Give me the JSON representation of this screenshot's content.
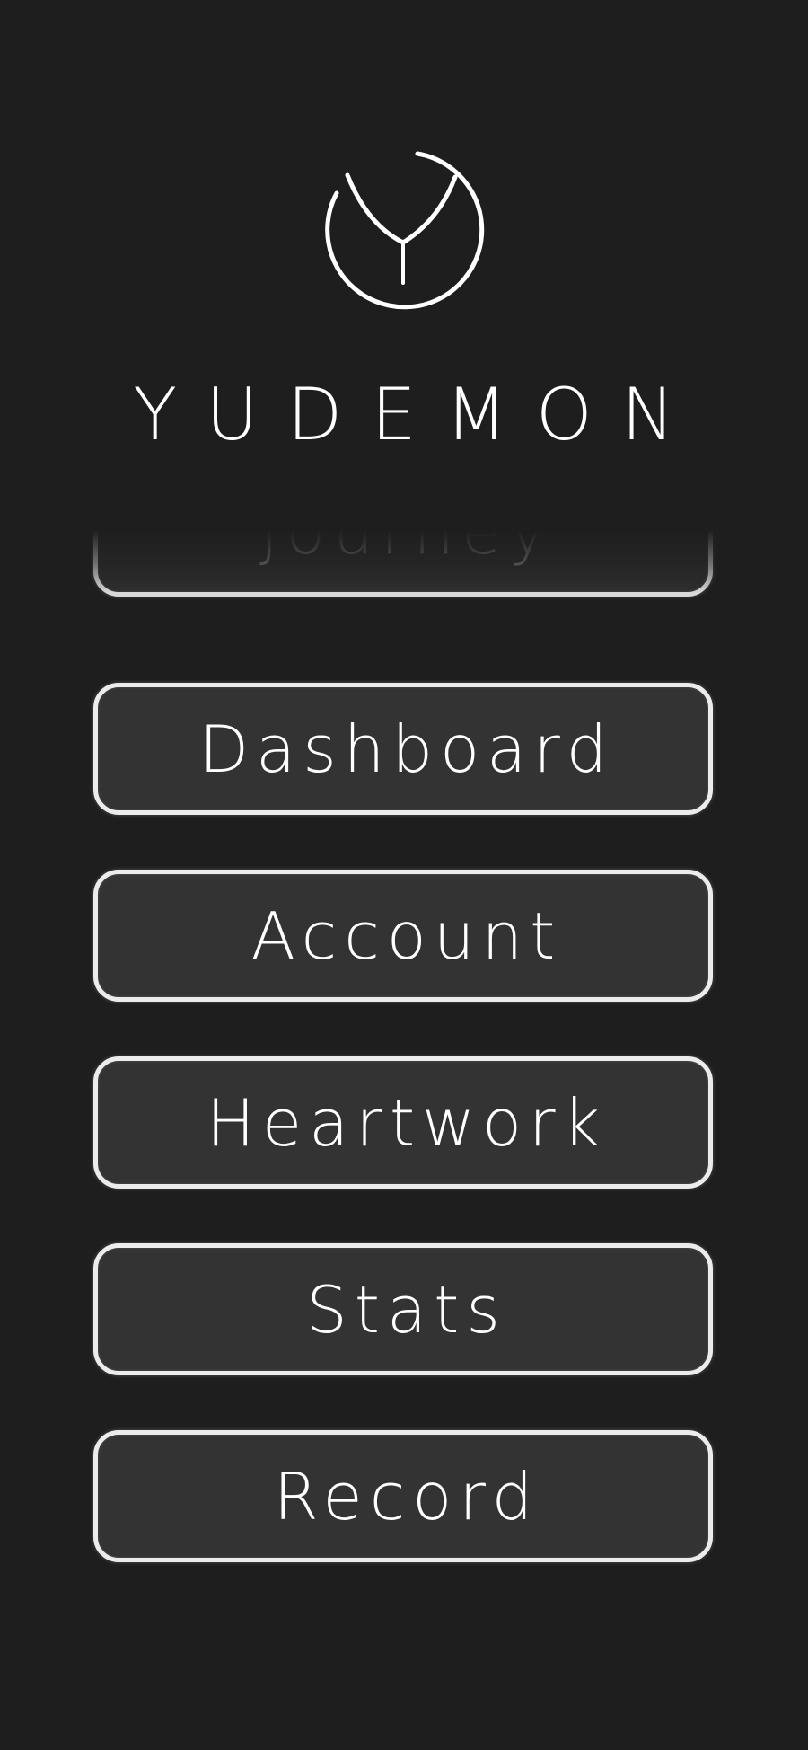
{
  "app": {
    "brand_name": "YUDEMON",
    "logo_icon": "yudemon-circle-y-icon"
  },
  "menu": {
    "items": [
      {
        "label": "Journey",
        "state": "partially-scrolled-out"
      },
      {
        "label": "Dashboard"
      },
      {
        "label": "Account"
      },
      {
        "label": "Heartwork"
      },
      {
        "label": "Stats"
      },
      {
        "label": "Record"
      }
    ]
  },
  "colors": {
    "background": "#1e1e1e",
    "button_fill": "#333333",
    "button_border": "#ececec",
    "text": "#ffffff",
    "faded_text": "#8a8a8a"
  }
}
